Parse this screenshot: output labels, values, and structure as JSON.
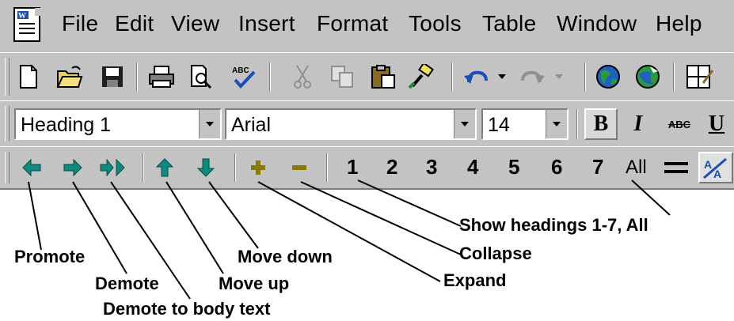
{
  "menubar": {
    "items": [
      {
        "label": "File",
        "icon": "word-document-icon"
      },
      {
        "label": "Edit"
      },
      {
        "label": "View"
      },
      {
        "label": "Insert"
      },
      {
        "label": "Format"
      },
      {
        "label": "Tools"
      },
      {
        "label": "Table"
      },
      {
        "label": "Window"
      },
      {
        "label": "Help"
      }
    ]
  },
  "standard_toolbar": {
    "icons": [
      "new-document-icon",
      "open-folder-icon",
      "save-disk-icon",
      "print-icon",
      "print-preview-icon",
      "spelling-check-icon",
      "cut-scissors-icon",
      "copy-icon",
      "paste-icon",
      "format-painter-icon",
      "undo-icon",
      "redo-icon",
      "web-globe-icon",
      "web-toolbar-icon",
      "tables-borders-icon"
    ]
  },
  "formatting_toolbar": {
    "style_value": "Heading 1",
    "font_value": "Arial",
    "size_value": "14",
    "bold_label": "B",
    "italic_label": "I",
    "strike_label": "ABC",
    "underline_label": "U"
  },
  "outline_toolbar": {
    "levels": [
      "1",
      "2",
      "3",
      "4",
      "5",
      "6",
      "7"
    ],
    "all_label": "All",
    "colors": {
      "arrow": "#0e8a80",
      "plus_minus": "#8a7a00"
    }
  },
  "callouts": {
    "promote": "Promote",
    "demote": "Demote",
    "demote_body": "Demote to body text",
    "move_up": "Move up",
    "move_down": "Move down",
    "expand": "Expand",
    "collapse": "Collapse",
    "show_headings": "Show headings 1-7, All"
  }
}
